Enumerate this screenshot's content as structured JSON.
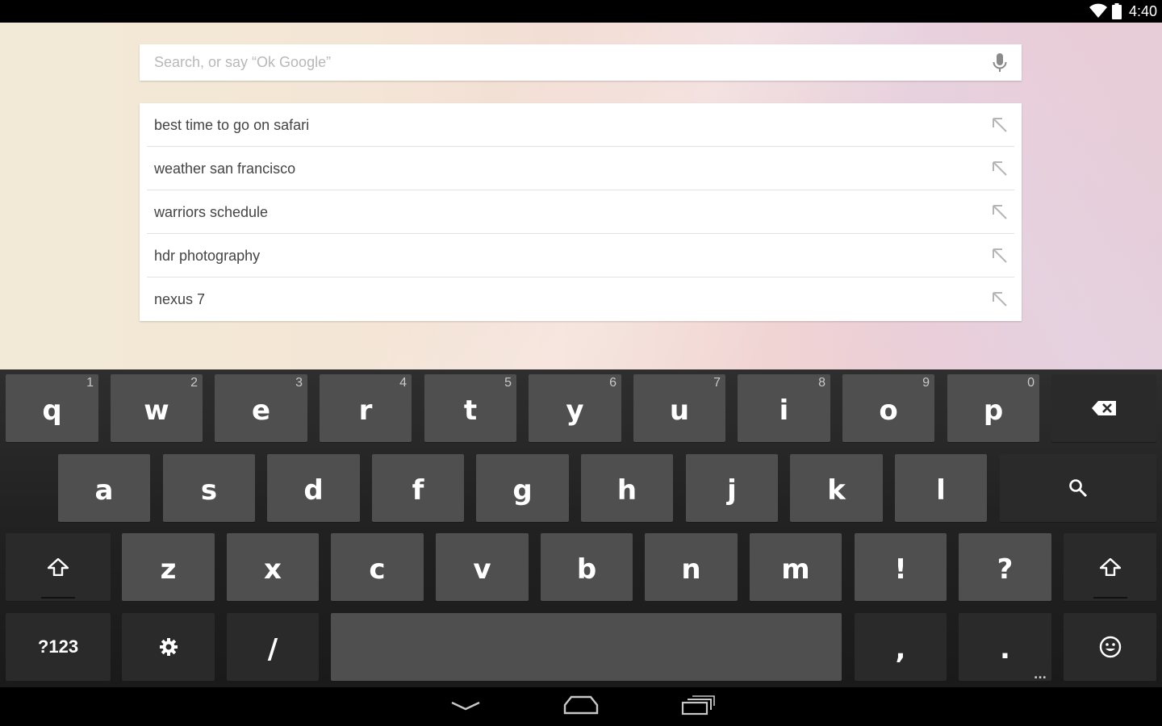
{
  "status_bar": {
    "time": "4:40",
    "icons": [
      "wifi-icon",
      "battery-icon"
    ]
  },
  "search": {
    "placeholder": "Search, or say “Ok Google”",
    "mic_icon": "microphone-icon"
  },
  "suggestions": [
    {
      "text": "best time to go on safari",
      "icon": "insert-query-arrow-icon"
    },
    {
      "text": "weather san francisco",
      "icon": "insert-query-arrow-icon"
    },
    {
      "text": "warriors schedule",
      "icon": "insert-query-arrow-icon"
    },
    {
      "text": "hdr photography",
      "icon": "insert-query-arrow-icon"
    },
    {
      "text": "nexus 7",
      "icon": "insert-query-arrow-icon"
    }
  ],
  "keyboard": {
    "row1": [
      {
        "label": "q",
        "hint": "1"
      },
      {
        "label": "w",
        "hint": "2"
      },
      {
        "label": "e",
        "hint": "3"
      },
      {
        "label": "r",
        "hint": "4"
      },
      {
        "label": "t",
        "hint": "5"
      },
      {
        "label": "y",
        "hint": "6"
      },
      {
        "label": "u",
        "hint": "7"
      },
      {
        "label": "i",
        "hint": "8"
      },
      {
        "label": "o",
        "hint": "9"
      },
      {
        "label": "p",
        "hint": "0"
      }
    ],
    "row2": [
      "a",
      "s",
      "d",
      "f",
      "g",
      "h",
      "j",
      "k",
      "l"
    ],
    "row3": [
      "z",
      "x",
      "c",
      "v",
      "b",
      "n",
      "m",
      "!",
      "?"
    ],
    "symbols_label": "?123",
    "slash_label": "/",
    "comma_label": ",",
    "period_label": ".",
    "period_more": "...",
    "icons": [
      "backspace-icon",
      "search-icon",
      "shift-icon",
      "settings-icon",
      "emoji-icon"
    ]
  },
  "colors": {
    "key": "#4f4f4f",
    "function_key": "#2a2a2a",
    "keyboard_bg": "#222222",
    "placeholder": "#b8b8b8",
    "suggestion_text": "#444444"
  },
  "nav_bar": {
    "icons": [
      "back-icon",
      "home-icon",
      "recents-icon"
    ]
  }
}
